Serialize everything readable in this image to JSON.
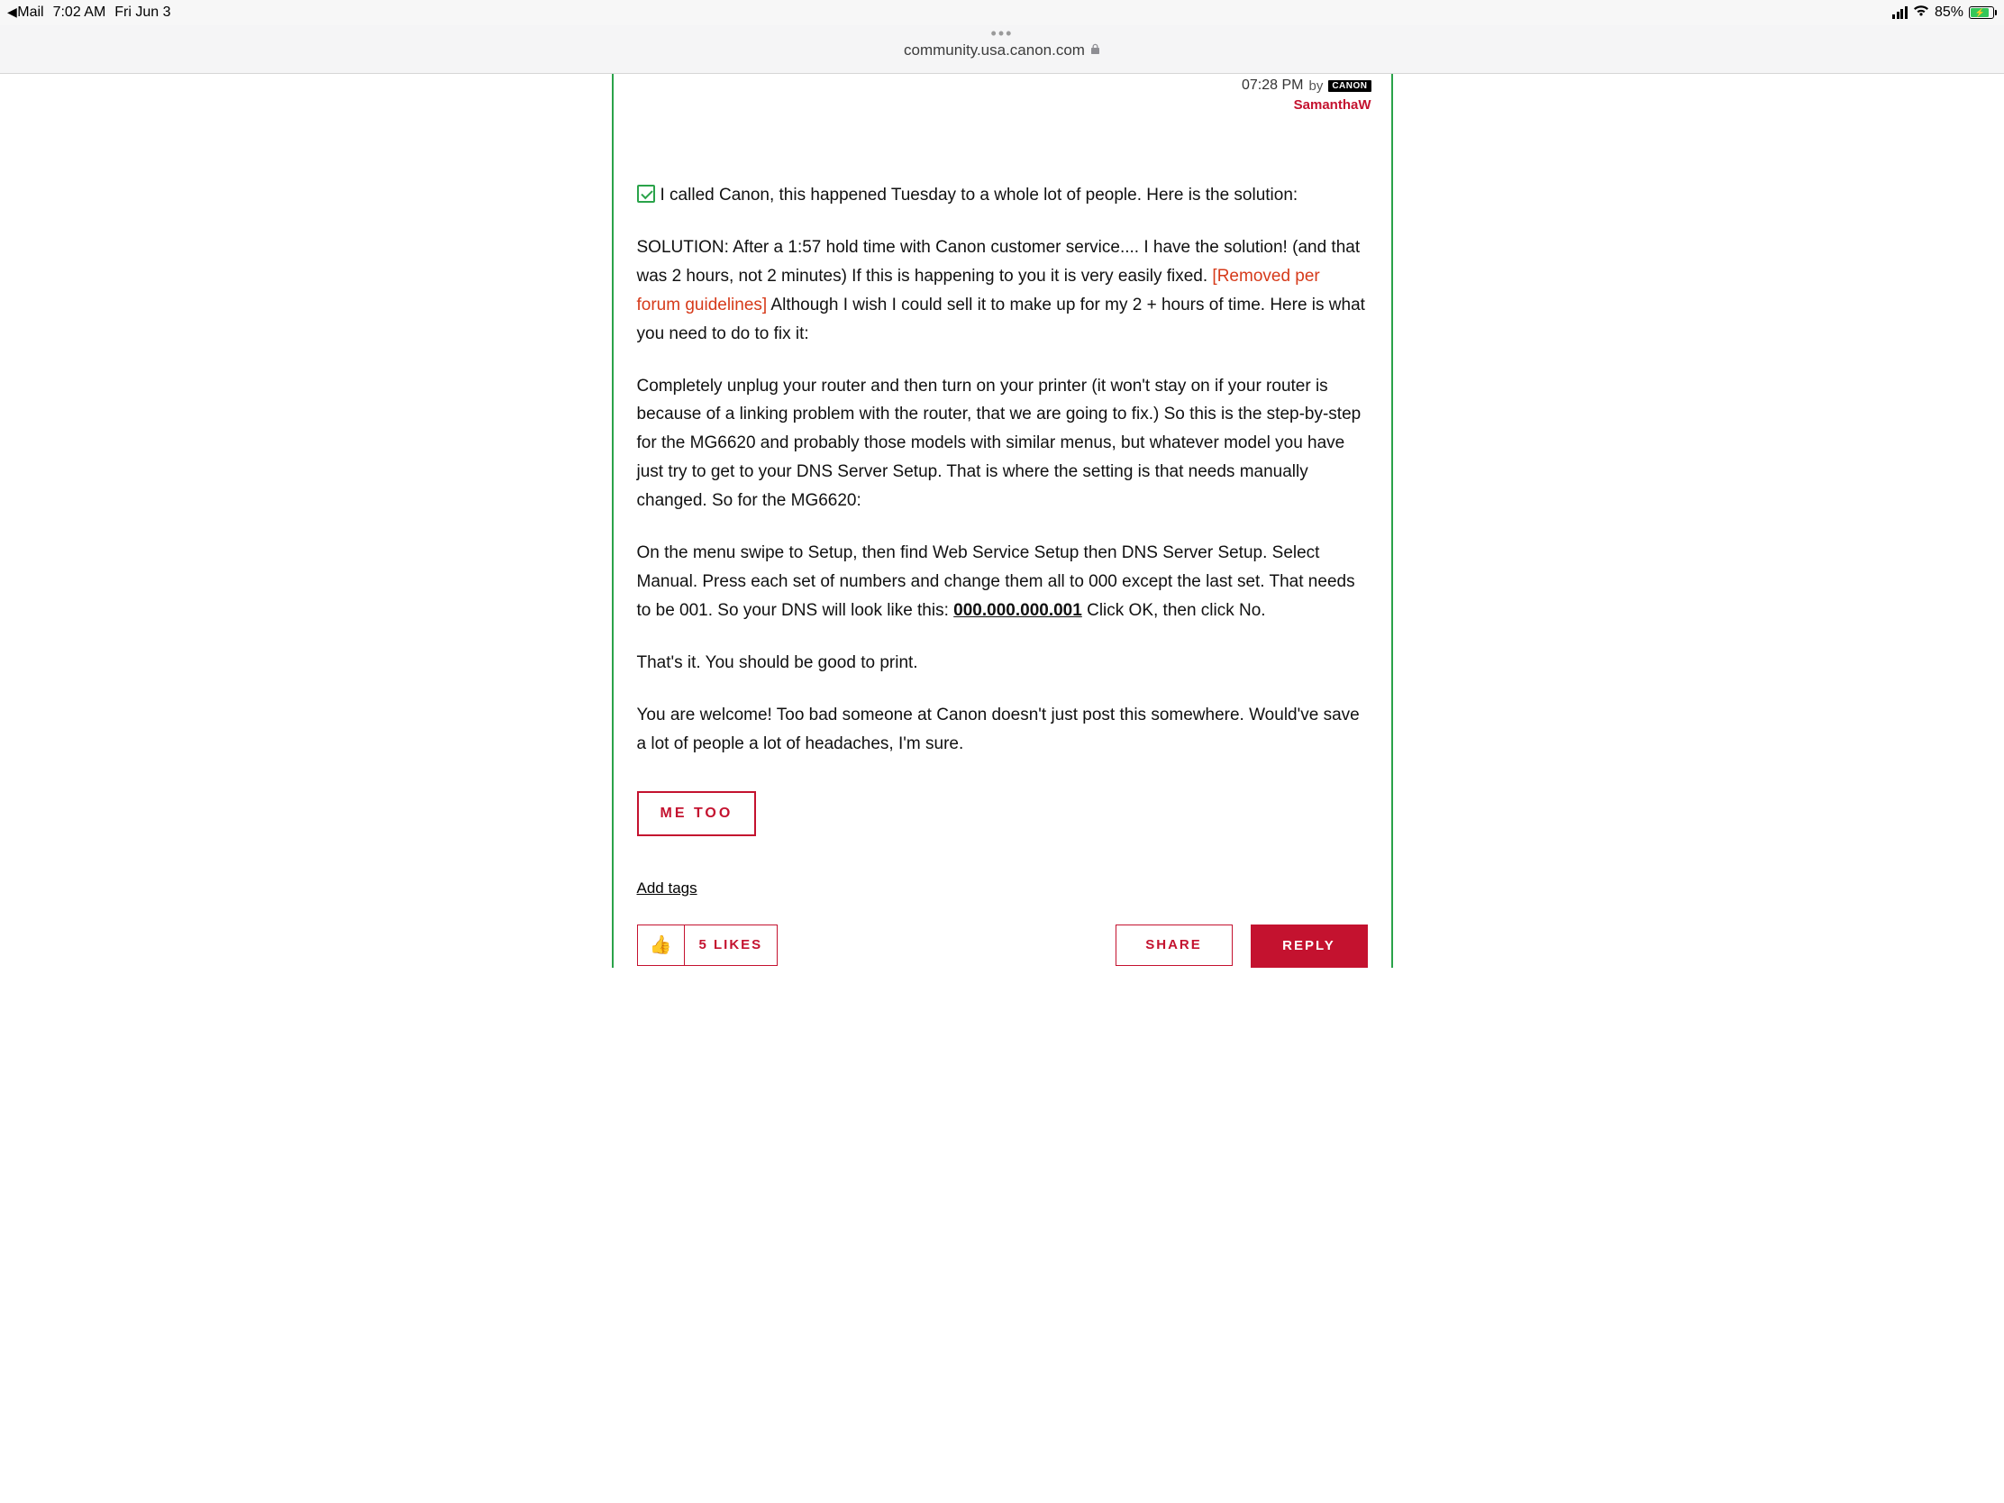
{
  "status": {
    "back_app": "Mail",
    "time": "7:02 AM",
    "date": "Fri Jun 3",
    "battery_pct": "85%"
  },
  "browser": {
    "url": "community.usa.canon.com"
  },
  "post": {
    "time": "07:28 PM",
    "by": "by",
    "brand_badge": "CANON",
    "author": "SamanthaW",
    "lead": "I called Canon, this happened Tuesday to a whole lot of people.  Here is the solution:",
    "p1a": "SOLUTION: After a 1:57 hold time with Canon customer service.... I have the solution! (and that was 2 hours, not 2 minutes) If this is happening to you it is very easily fixed. ",
    "p1_removed": "[Removed per forum guidelines]",
    "p1b": "  Although I wish I could sell it to make up for my 2 + hours of time.  Here is what you need to do to fix it:",
    "p2": "Completely unplug your router and then turn on your printer (it won't stay on if your router is because of a linking problem with the router, that we are going to fix.)  So this is the step-by-step for the MG6620 and probably those models with similar menus, but whatever model you have just try to get to your DNS Server Setup. That is where the setting is that needs manually changed. So for the MG6620:",
    "p3a": "On the menu swipe to Setup, then find Web Service Setup then DNS Server Setup. Select Manual. Press each set of numbers and change them all to 000 except the last set. That needs to be 001. So your DNS will look like this: ",
    "p3_dns": "000.000.000.001",
    "p3b": "  Click OK, then click No.",
    "p4": "That's it. You should be good to print.",
    "p5": "You are welcome!  Too bad someone at Canon doesn't just post this somewhere. Would've save a lot of people a lot of headaches, I'm sure."
  },
  "buttons": {
    "me_too": "ME TOO",
    "add_tags": "Add tags",
    "likes": "5 LIKES",
    "share": "SHARE",
    "reply": "REPLY"
  }
}
